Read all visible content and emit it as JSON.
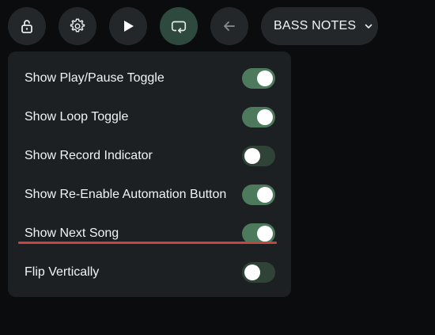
{
  "toolbar": {
    "buttons": [
      {
        "icon": "unlock-icon",
        "active": false
      },
      {
        "icon": "gear-icon",
        "active": false
      },
      {
        "icon": "play-icon",
        "active": false
      },
      {
        "icon": "loop-icon",
        "active": true
      },
      {
        "icon": "arrow-left-icon",
        "active": false
      }
    ],
    "dropdown": {
      "label": "BASS NOTES",
      "icon": "chevron-down-icon"
    }
  },
  "settings": {
    "items": [
      {
        "label": "Show Play/Pause Toggle",
        "enabled": true
      },
      {
        "label": "Show Loop Toggle",
        "enabled": true
      },
      {
        "label": "Show Record Indicator",
        "enabled": false
      },
      {
        "label": "Show Re-Enable Automation Button",
        "enabled": true
      },
      {
        "label": "Show Next Song",
        "enabled": true,
        "highlighted": true
      },
      {
        "label": "Flip Vertically",
        "enabled": false
      }
    ]
  },
  "colors": {
    "background": "#0b0c0d",
    "panel": "#1d2023",
    "button": "#24272a",
    "button_active": "#2e4a3e",
    "toggle_on": "#4d7a5c",
    "toggle_off": "#2f4437",
    "highlight_underline": "#c6453f"
  }
}
